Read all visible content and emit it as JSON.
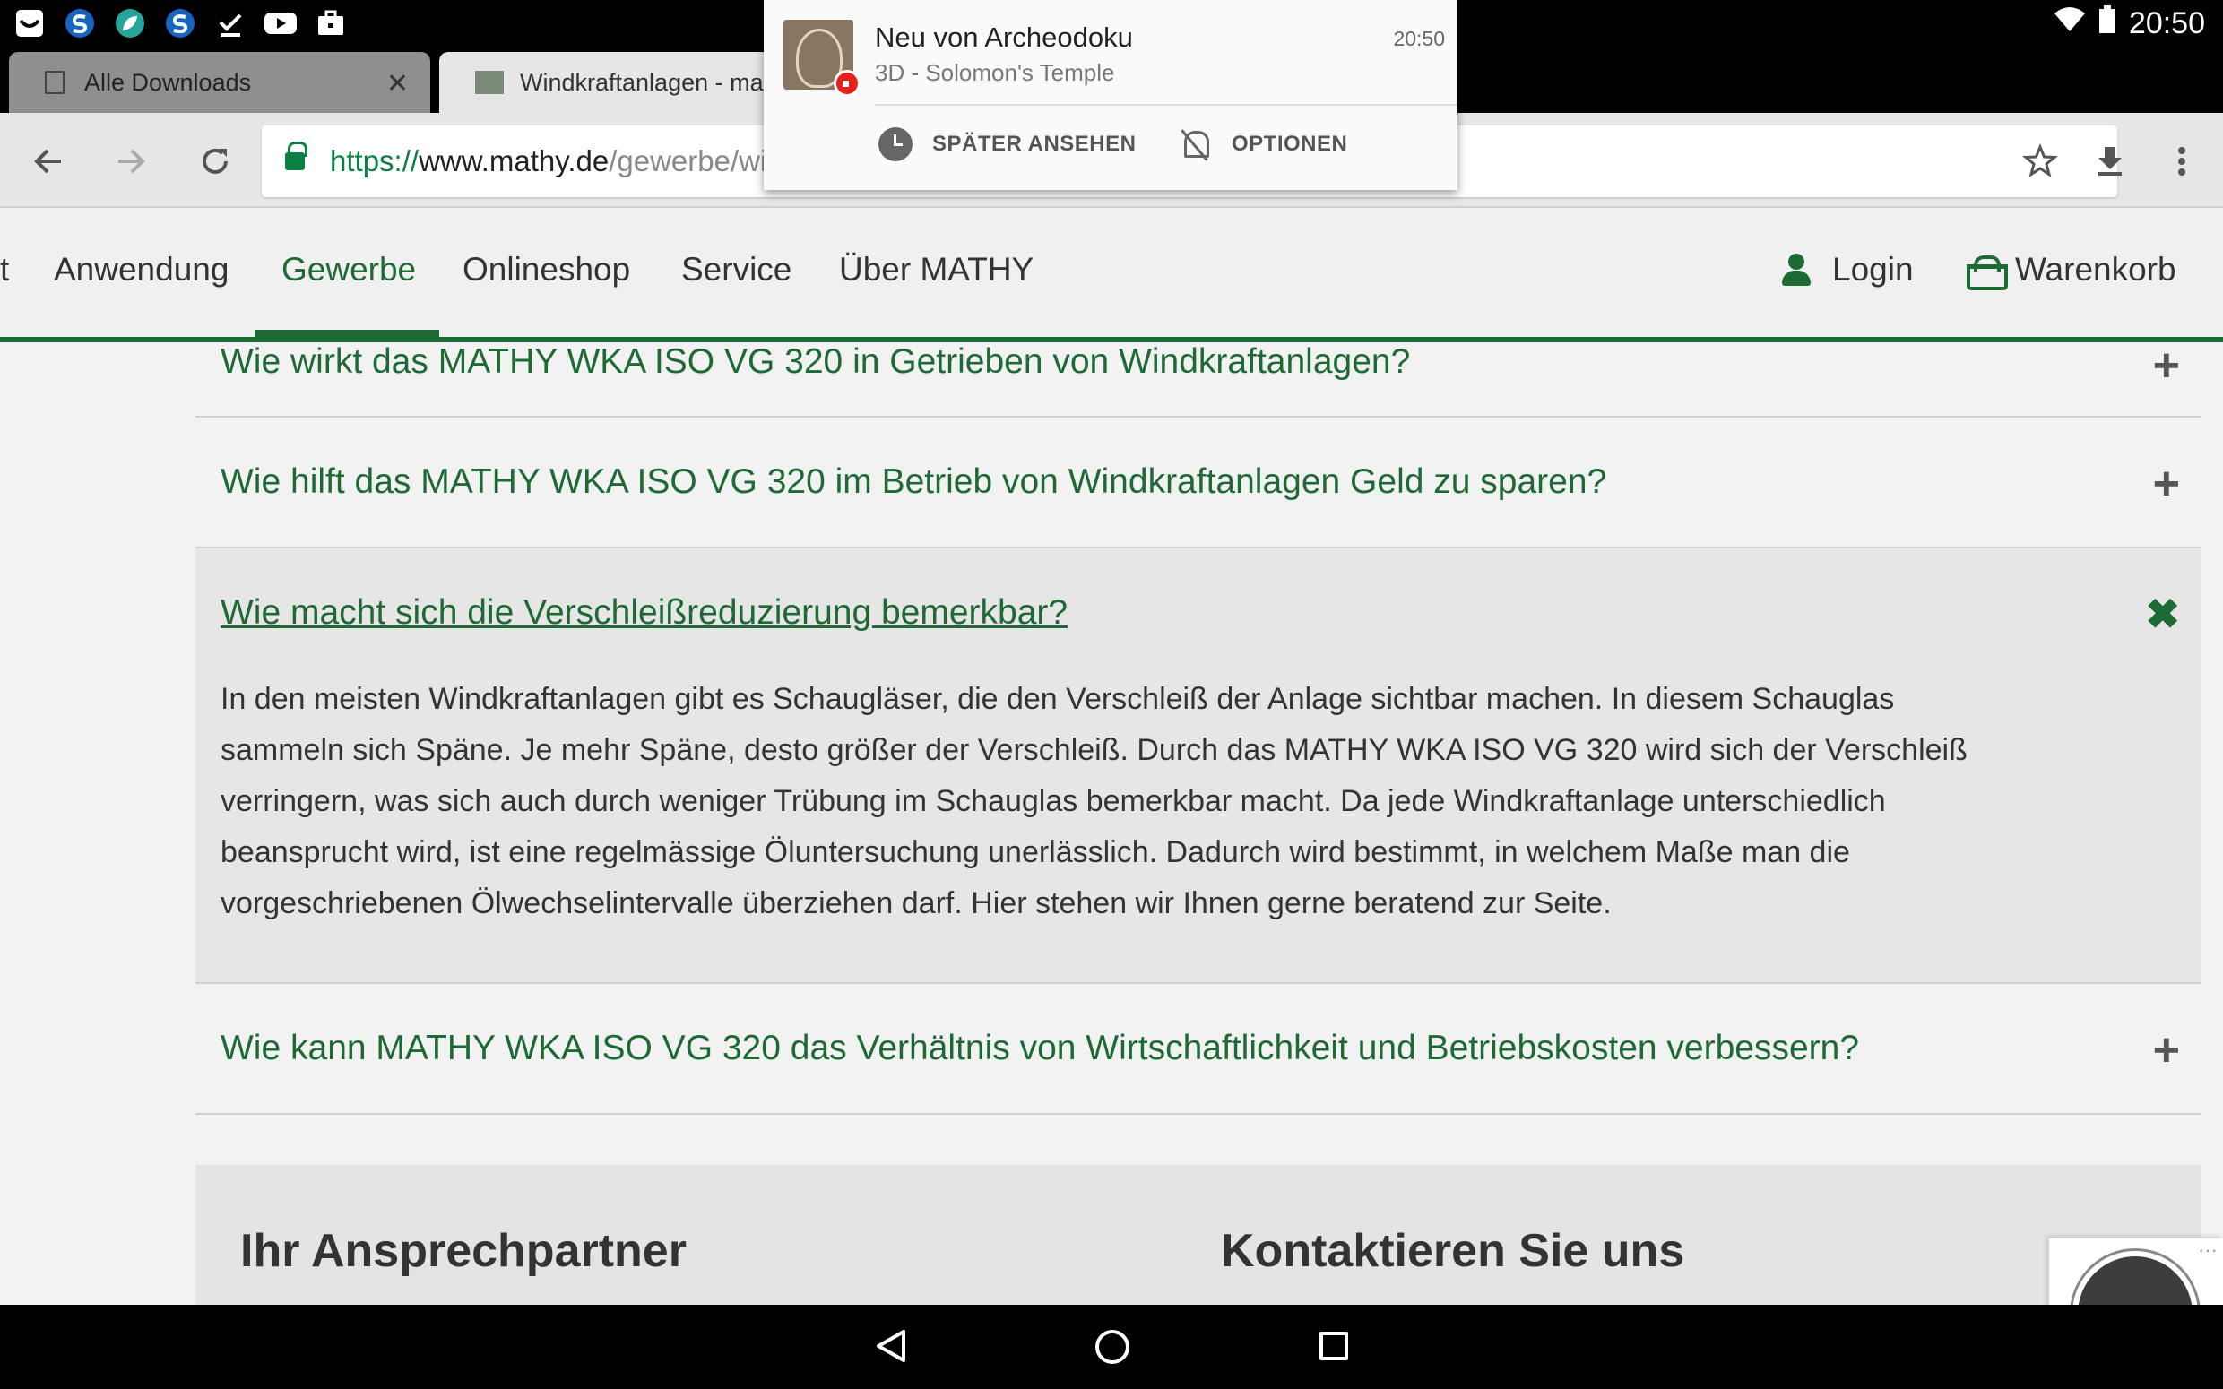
{
  "status_bar": {
    "time": "20:50",
    "left_icons": [
      "inbox-icon",
      "s-app-icon",
      "leaf-app-icon",
      "s-app-icon",
      "check-download-icon",
      "youtube-icon",
      "briefcase-icon"
    ],
    "right_icons": [
      "wifi-icon",
      "battery-icon"
    ]
  },
  "browser": {
    "tabs": [
      {
        "label": "Alle Downloads",
        "active": false
      },
      {
        "label": "Windkraftanlagen - mathy",
        "active": true
      }
    ],
    "url_scheme": "https://",
    "url_host": "www.mathy.de",
    "url_path": "/gewerbe/wir"
  },
  "notification": {
    "title": "Neu von Archeodoku",
    "subtitle": "3D - Solomon's Temple",
    "time": "20:50",
    "actions": [
      "SPÄTER ANSEHEN",
      "OPTIONEN"
    ]
  },
  "site_nav": {
    "items": [
      "t",
      "Anwendung",
      "Gewerbe",
      "Onlineshop",
      "Service",
      "Über MATHY"
    ],
    "active": "Gewerbe",
    "login": "Login",
    "cart": "Warenkorb"
  },
  "faq": [
    {
      "question": "Wie wirkt das MATHY WKA ISO VG 320 in Getrieben von Windkraftanlagen?",
      "open": false,
      "toggle": "+"
    },
    {
      "question": "Wie hilft das MATHY WKA ISO VG 320 im Betrieb von Windkraftanlagen Geld zu sparen?",
      "open": false,
      "toggle": "+"
    },
    {
      "question": "Wie macht sich die Verschleißreduzierung bemerkbar?",
      "open": true,
      "toggle": "✖",
      "answer_lines": [
        "In den meisten Windkraftanlagen gibt es Schaugläser, die den Verschleiß der Anlage sichtbar machen. In diesem Schauglas",
        "sammeln sich Späne. Je mehr Späne, desto größer der Verschleiß. Durch das MATHY WKA ISO VG 320 wird sich der Verschleiß",
        "verringern, was sich auch durch weniger Trübung im Schauglas bemerkbar macht. Da jede Windkraftanlage unterschiedlich",
        "beansprucht wird, ist eine regelmässige Öluntersuchung unerlässlich. Dadurch wird bestimmt, in welchem Maße man die",
        "vorgeschriebenen Ölwechselintervalle überziehen darf. Hier stehen wir Ihnen gerne beratend zur Seite."
      ]
    },
    {
      "question": "Wie kann MATHY WKA ISO VG 320 das Verhältnis von Wirtschaftlichkeit und Betriebskosten verbessern?",
      "open": false,
      "toggle": "+"
    }
  ],
  "contact": {
    "left_heading": "Ihr Ansprechpartner",
    "right_heading": "Kontaktieren Sie uns"
  },
  "trusted_badge": {
    "dots": "···"
  },
  "colors": {
    "brand_green": "#1e6a34",
    "page_bg": "#f2f2f2",
    "chrome_url_green": "#0b8043"
  }
}
